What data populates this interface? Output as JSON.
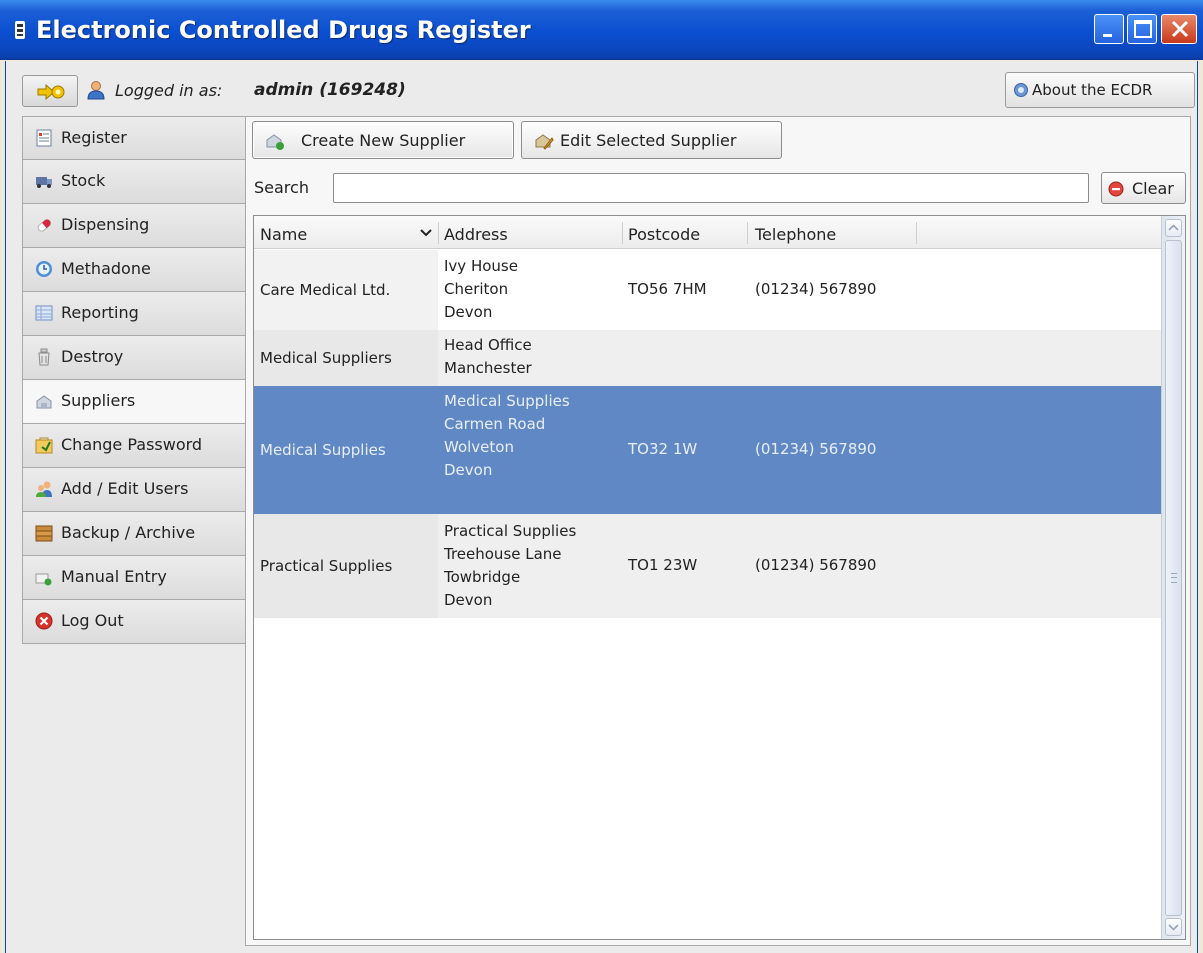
{
  "window": {
    "title": "Electronic Controlled Drugs Register",
    "controls": [
      "minimize-icon",
      "maximize-icon",
      "close-icon"
    ]
  },
  "topbar": {
    "logged_in_label": "Logged in as:",
    "logged_in_user": "admin (169248)",
    "about_label": "About the ECDR"
  },
  "sidebar": {
    "items": [
      {
        "label": "Register",
        "icon": "register-icon"
      },
      {
        "label": "Stock",
        "icon": "stock-icon"
      },
      {
        "label": "Dispensing",
        "icon": "dispensing-icon"
      },
      {
        "label": "Methadone",
        "icon": "methadone-icon"
      },
      {
        "label": "Reporting",
        "icon": "reporting-icon"
      },
      {
        "label": "Destroy",
        "icon": "destroy-icon"
      },
      {
        "label": "Suppliers",
        "icon": "suppliers-icon",
        "active": true
      },
      {
        "label": "Change Password",
        "icon": "password-icon"
      },
      {
        "label": "Add / Edit Users",
        "icon": "users-icon"
      },
      {
        "label": "Backup / Archive",
        "icon": "backup-icon"
      },
      {
        "label": "Manual Entry",
        "icon": "manual-entry-icon"
      },
      {
        "label": "Log Out",
        "icon": "logout-icon"
      }
    ]
  },
  "toolbar": {
    "create_label": "Create New Supplier",
    "edit_label": "Edit Selected Supplier"
  },
  "search": {
    "label": "Search",
    "value": "",
    "placeholder": "",
    "clear_label": "Clear"
  },
  "table": {
    "columns": [
      "Name",
      "Address",
      "Postcode",
      "Telephone"
    ],
    "sort_column": "Name",
    "rows": [
      {
        "name": "Care Medical Ltd.",
        "address": [
          "Ivy House",
          "Cheriton",
          "Devon"
        ],
        "postcode": "TO56 7HM",
        "telephone": "(01234) 567890",
        "selected": false
      },
      {
        "name": "Medical Suppliers",
        "address": [
          "Head Office",
          "Manchester"
        ],
        "postcode": "",
        "telephone": "",
        "selected": false
      },
      {
        "name": "Medical Supplies",
        "address": [
          "Medical Supplies",
          "Carmen Road",
          "Wolveton",
          "Devon"
        ],
        "postcode": "TO32 1W",
        "telephone": "(01234) 567890",
        "selected": true
      },
      {
        "name": "Practical Supplies",
        "address": [
          "Practical Supplies",
          "Treehouse Lane",
          "Towbridge",
          "Devon"
        ],
        "postcode": "TO1 23W",
        "telephone": "(01234) 567890",
        "selected": false
      }
    ]
  },
  "colors": {
    "titlebar": "#0a4fd0",
    "selected_row": "#5f88c4",
    "close_button": "#c8391b"
  }
}
